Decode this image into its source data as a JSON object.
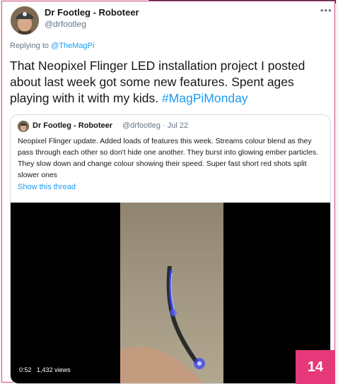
{
  "tweet": {
    "author_name": "Dr Footleg - Roboteer",
    "author_handle": "@drfootleg",
    "more_icon": "more-dots-icon",
    "reply_prefix": "Replying to",
    "reply_to": "@TheMagPi",
    "text": "That Neopixel Flinger LED installation project I posted about last week got some new features. Spent ages playing with it with my kids.",
    "hashtag": "#MagPiMonday"
  },
  "quoted_tweet": {
    "author_name": "Dr Footleg - Roboteer",
    "author_handle_date": "@drfootleg · Jul 22",
    "text": "Neopixel Flinger update. Added loads of features this week. Streams colour blend as they pass through each other so don't hide one another. They burst into glowing ember particles. They slow down and change colour showing their speed. Super fast short red shots split slower ones",
    "show_thread": "Show this thread",
    "video": {
      "duration": "0:52",
      "views": "1,432 views"
    }
  },
  "page_number": "14",
  "colors": {
    "link_blue": "#1d9bf0",
    "badge_pink": "#e5397a",
    "frame_pink": "#d94a8c"
  }
}
